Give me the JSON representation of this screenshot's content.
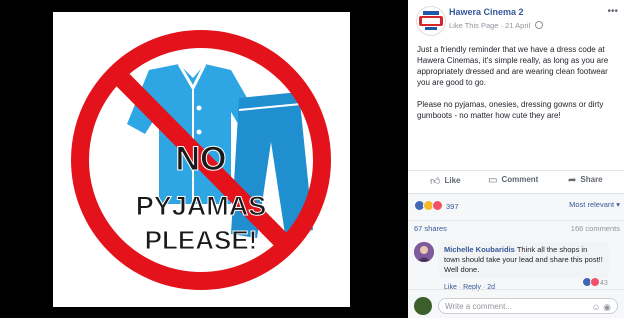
{
  "image": {
    "alt_elements": "no-pyjamas-sign",
    "sign_lines": [
      "NO",
      "PYJAMAS",
      "PLEASE!"
    ],
    "colors": {
      "ring": "#e4131b",
      "garment": "#2fa6e4",
      "text": "#1a1a1a"
    }
  },
  "post": {
    "page_name": "Hawera Cinema 2",
    "like_page": "Like This Page",
    "date": "21 April",
    "paragraphs": [
      "Just a friendly reminder that we have a dress code at Hawera Cinemas, it's simple really, as long as you are appropriately dressed and are wearing clean footwear you are good to go.",
      "Please no pyjamas, onesies, dressing gowns or dirty gumboots - no matter how cute they are!"
    ]
  },
  "actions": {
    "like": "Like",
    "comment": "Comment",
    "share": "Share"
  },
  "reactions": {
    "count": "397",
    "sort": "Most relevant"
  },
  "stats": {
    "shares": "67 shares",
    "comments": "166 comments"
  },
  "comment": {
    "author": "Michelle Koubaridis",
    "text": "Think all the shops in town should take your lead and share this post!! Well done.",
    "like": "Like",
    "reply": "Reply",
    "age": "2d",
    "reaction_count": "43"
  },
  "composer": {
    "placeholder": "Write a comment..."
  }
}
